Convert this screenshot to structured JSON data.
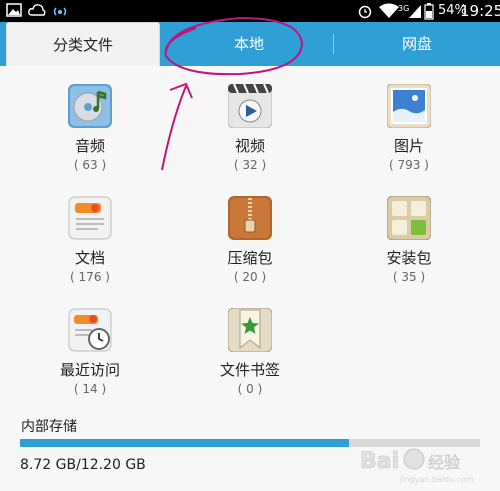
{
  "status_bar": {
    "signal_tag": "3G",
    "battery": "54%",
    "time": "19:25",
    "icons": [
      "gallery-icon",
      "cloud-icon",
      "wifi-hotspot-icon",
      "alarm-icon",
      "wifi-icon",
      "signal-icon",
      "battery-icon"
    ]
  },
  "tabs": [
    {
      "label": "分类文件",
      "active": true
    },
    {
      "label": "本地",
      "active": false
    },
    {
      "label": "网盘",
      "active": false
    }
  ],
  "categories": [
    {
      "label": "音频",
      "count": "( 63 )",
      "icon": "music-disc-icon"
    },
    {
      "label": "视频",
      "count": "( 32 )",
      "icon": "video-icon"
    },
    {
      "label": "图片",
      "count": "( 793 )",
      "icon": "picture-icon"
    },
    {
      "label": "文档",
      "count": "( 176 )",
      "icon": "document-icon"
    },
    {
      "label": "压缩包",
      "count": "( 20 )",
      "icon": "zip-icon"
    },
    {
      "label": "安装包",
      "count": "( 35 )",
      "icon": "apk-package-icon"
    },
    {
      "label": "最近访问",
      "count": "( 14 )",
      "icon": "recent-clock-icon"
    },
    {
      "label": "文件书签",
      "count": "( 0 )",
      "icon": "bookmark-star-icon"
    }
  ],
  "storage": {
    "title": "内部存储",
    "usage_text": "8.72 GB/12.20 GB",
    "used_fraction": 0.715
  },
  "colors": {
    "accent": "#2f9fd6",
    "annotation": "#c0157a"
  }
}
